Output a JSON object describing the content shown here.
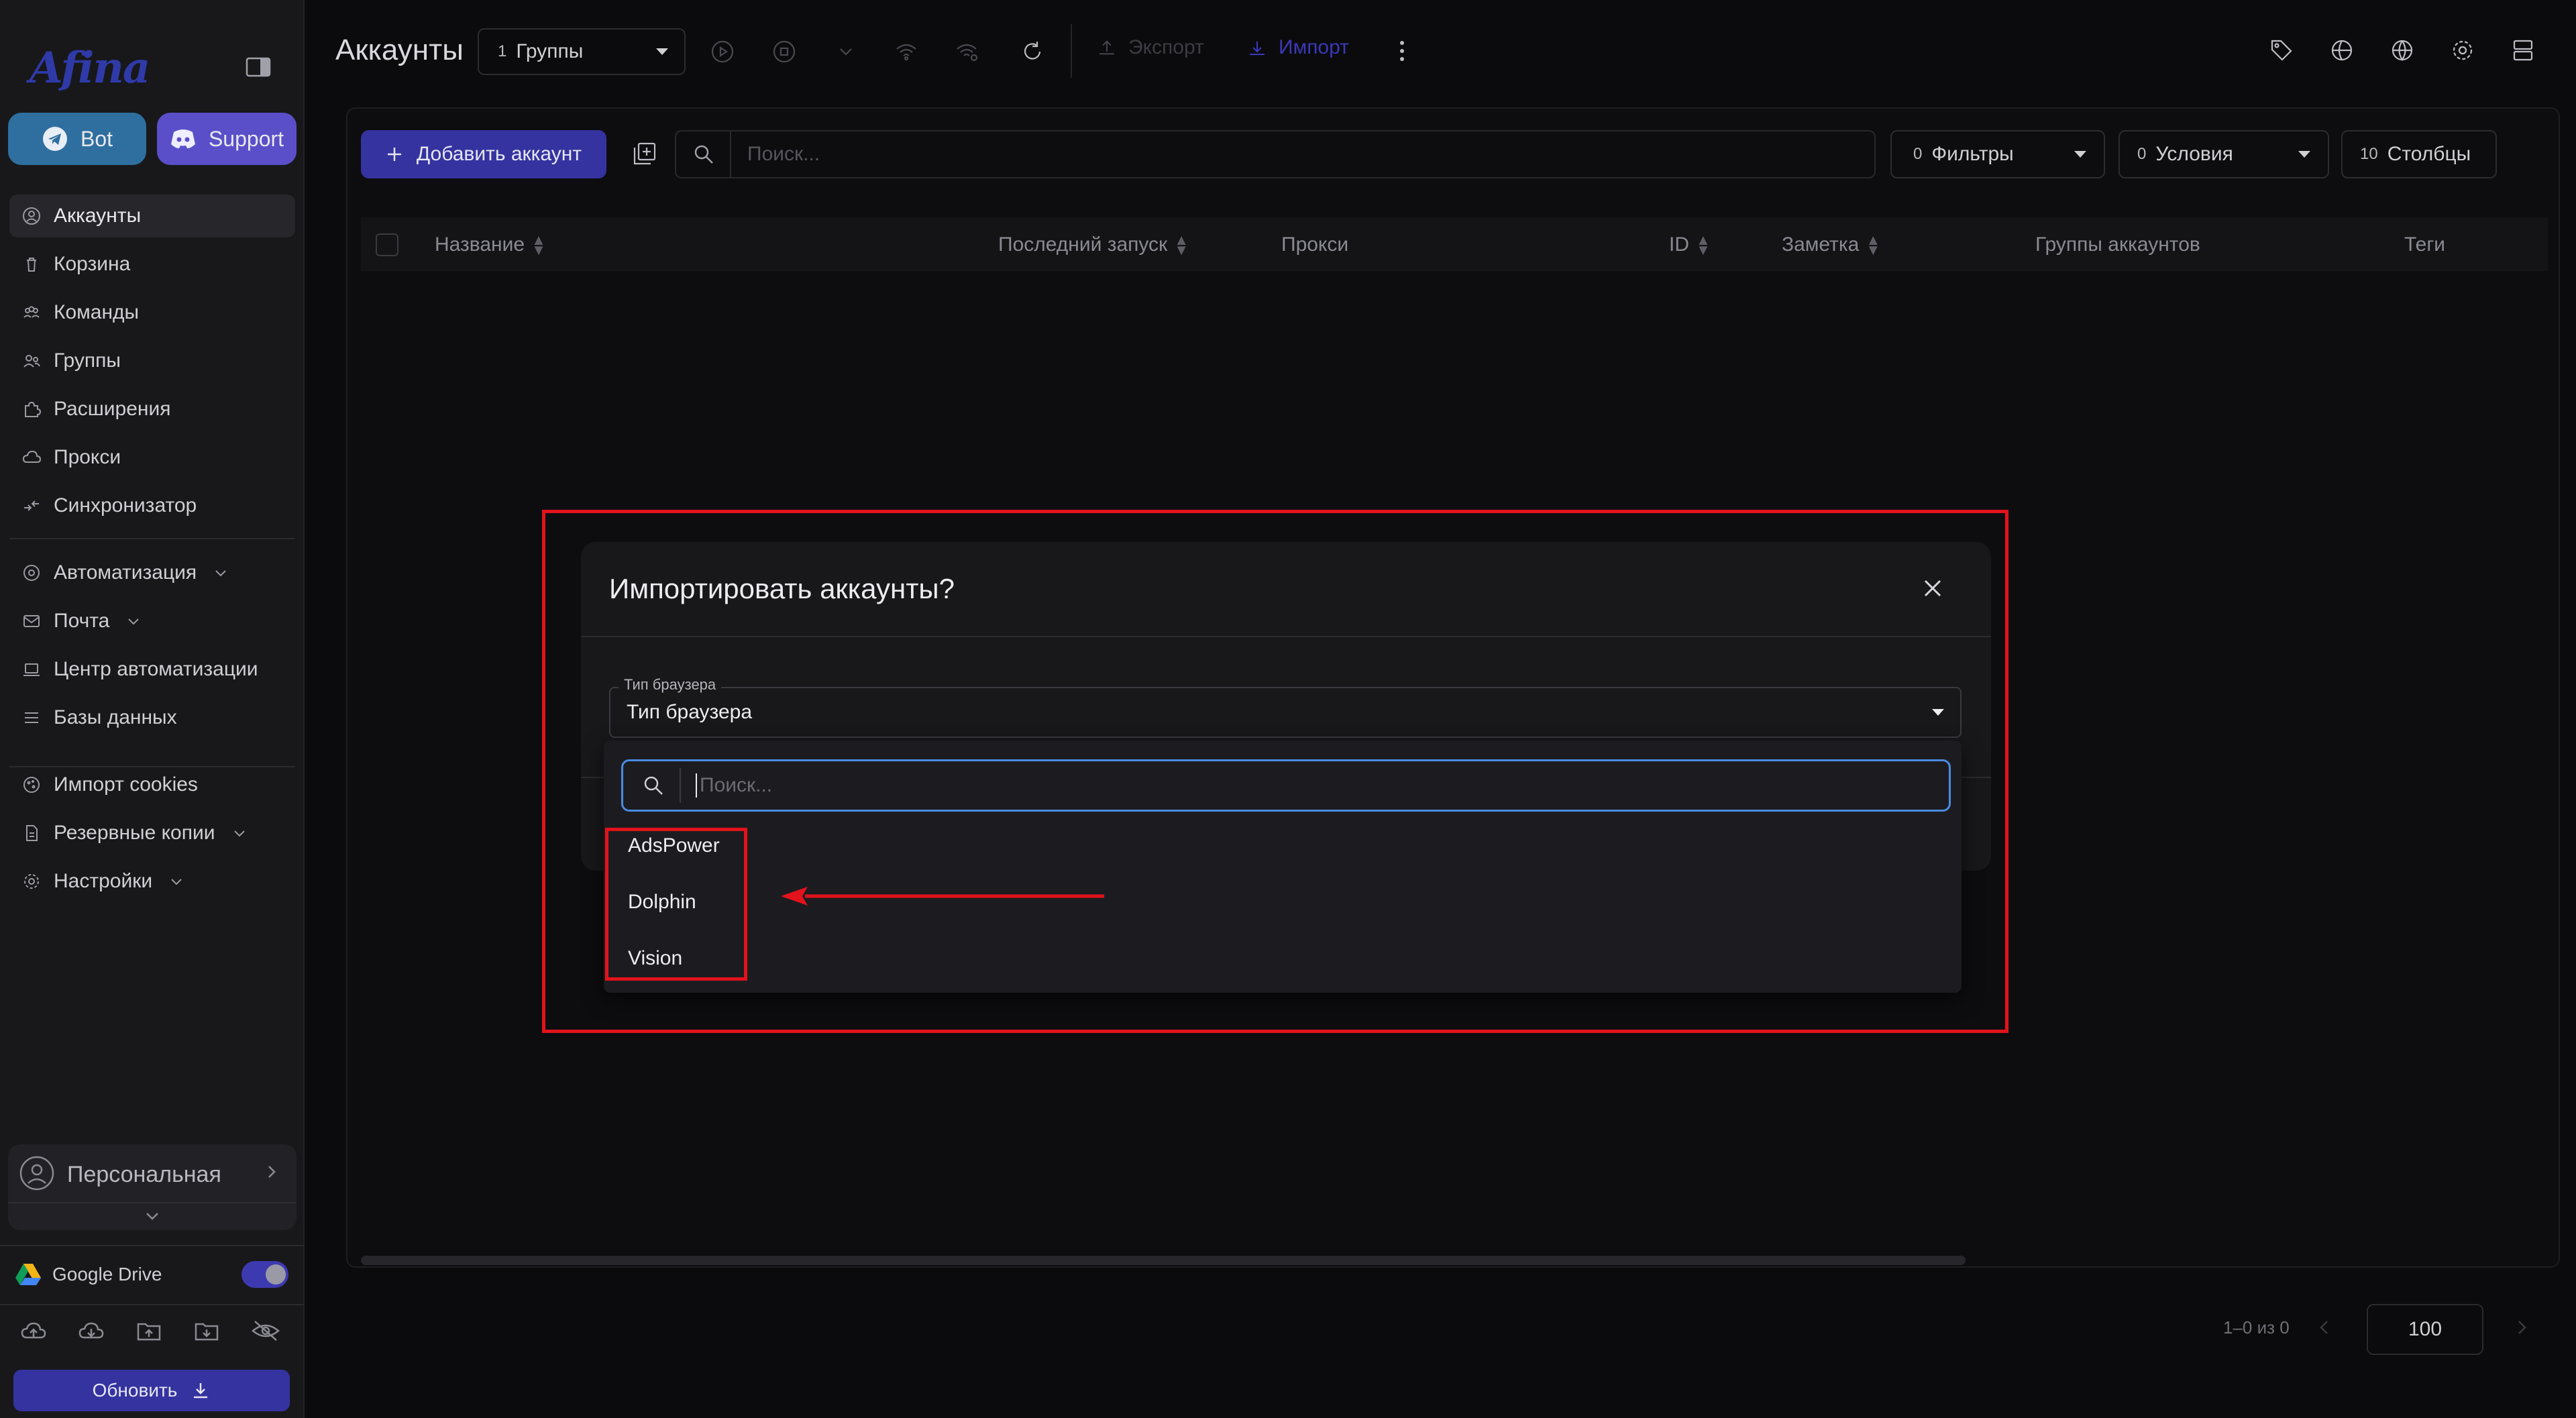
{
  "app": {
    "logo": "Afina",
    "bot_label": "Bot",
    "support_label": "Support"
  },
  "sidebar": {
    "items": [
      {
        "label": "Аккаунты"
      },
      {
        "label": "Корзина"
      },
      {
        "label": "Команды"
      },
      {
        "label": "Группы"
      },
      {
        "label": "Расширения"
      },
      {
        "label": "Прокси"
      },
      {
        "label": "Синхронизатор"
      },
      {
        "label": "Автоматизация"
      },
      {
        "label": "Почта"
      },
      {
        "label": "Центр автоматизации"
      },
      {
        "label": "Базы данных"
      },
      {
        "label": "Импорт cookies"
      },
      {
        "label": "Резервные копии"
      },
      {
        "label": "Настройки"
      }
    ],
    "workspace": "Персональная",
    "google_drive": "Google Drive",
    "update_label": "Обновить"
  },
  "header": {
    "title": "Аккаунты",
    "groups_count": "1",
    "groups_label": "Группы",
    "export_label": "Экспорт",
    "import_label": "Импорт"
  },
  "toolbar": {
    "add_account": "Добавить аккаунт",
    "search_placeholder": "Поиск...",
    "filters_count": "0",
    "filters_label": "Фильтры",
    "conditions_count": "0",
    "conditions_label": "Условия",
    "columns_count": "10",
    "columns_label": "Столбцы"
  },
  "table": {
    "columns": [
      "Название",
      "Последний запуск",
      "Прокси",
      "ID",
      "Заметка",
      "Группы аккаунтов",
      "Теги"
    ]
  },
  "modal": {
    "title": "Импортировать аккаунты?",
    "field_label": "Тип браузера",
    "field_value": "Тип браузера",
    "search_placeholder": "Поиск...",
    "options": [
      "AdsPower",
      "Dolphin",
      "Vision"
    ]
  },
  "footer": {
    "range": "1–0 из 0",
    "per_page": "100"
  },
  "colors": {
    "accent": "#3533a0",
    "highlight": "#e3121b",
    "focus": "#4a8be0",
    "bot": "#2f6f9f",
    "support": "#5a4fc9"
  }
}
